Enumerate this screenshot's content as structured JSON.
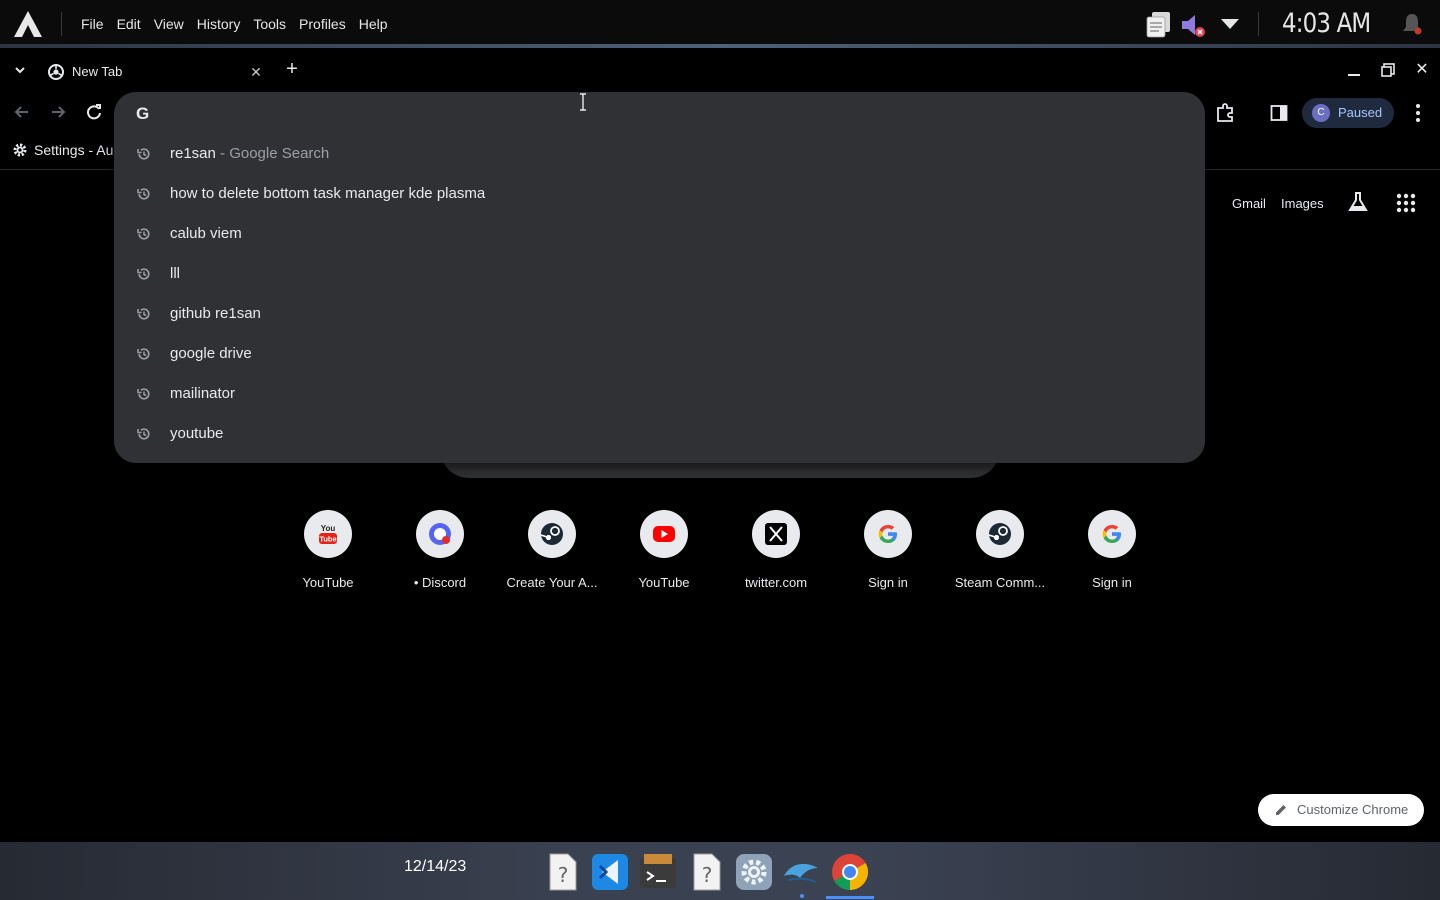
{
  "system_bar": {
    "menus": [
      "File",
      "Edit",
      "View",
      "History",
      "Tools",
      "Profiles",
      "Help"
    ],
    "clock": "4:03 AM"
  },
  "tab_strip": {
    "tab_title": "New Tab",
    "close_glyph": "✕",
    "new_tab_glyph": "+",
    "window_close_glyph": "✕"
  },
  "toolbar": {
    "profile_initial": "C",
    "profile_status": "Paused"
  },
  "bookmarks": {
    "item_label": "Settings - Au"
  },
  "omnibox": {
    "value": "",
    "leading_icon": "G",
    "suggestions": [
      {
        "text": "re1san",
        "suffix": " - Google Search"
      },
      {
        "text": "how to delete bottom task manager kde plasma",
        "suffix": ""
      },
      {
        "text": "calub viem",
        "suffix": ""
      },
      {
        "text": "lll",
        "suffix": ""
      },
      {
        "text": "github re1san",
        "suffix": ""
      },
      {
        "text": "google drive",
        "suffix": ""
      },
      {
        "text": "mailinator",
        "suffix": ""
      },
      {
        "text": "youtube",
        "suffix": ""
      }
    ]
  },
  "ntp": {
    "gmail": "Gmail",
    "images": "Images",
    "shortcuts": [
      {
        "label": "YouTube",
        "icon": "youtube-classic-icon"
      },
      {
        "label": "• Discord",
        "icon": "discord-icon"
      },
      {
        "label": "Create Your A...",
        "icon": "steam-icon"
      },
      {
        "label": "YouTube",
        "icon": "youtube-icon"
      },
      {
        "label": "twitter.com",
        "icon": "x-icon"
      },
      {
        "label": "Sign in",
        "icon": "google-icon"
      },
      {
        "label": "Steam Comm...",
        "icon": "steam-icon"
      },
      {
        "label": "Sign in",
        "icon": "google-icon"
      }
    ],
    "customize_label": "Customize Chrome"
  },
  "dock": {
    "date": "12/14/23",
    "items": [
      "unknown-file-icon",
      "vscode-icon",
      "terminal-icon",
      "unknown-file-icon",
      "settings-icon",
      "dolphin-icon",
      "chrome-icon"
    ]
  },
  "colors": {
    "dropdown_bg": "#303134",
    "profile_bg": "#1f2a3f",
    "profile_text": "#a8c7fa",
    "accent": "#4a90ff"
  }
}
